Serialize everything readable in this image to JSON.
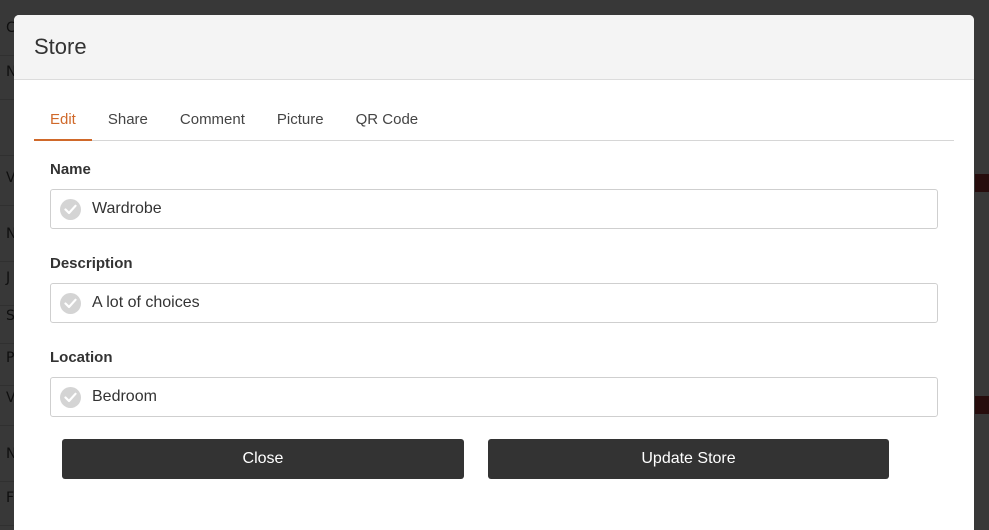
{
  "background": {
    "row_fragments": [
      "C",
      "N",
      "",
      "V",
      "N",
      "J",
      "S",
      "P",
      "V",
      "N",
      "F"
    ]
  },
  "modal": {
    "title": "Store",
    "tabs": [
      {
        "label": "Edit",
        "active": true
      },
      {
        "label": "Share",
        "active": false
      },
      {
        "label": "Comment",
        "active": false
      },
      {
        "label": "Picture",
        "active": false
      },
      {
        "label": "QR Code",
        "active": false
      }
    ],
    "fields": {
      "name": {
        "label": "Name",
        "value": "Wardrobe",
        "icon": "check-circle-icon"
      },
      "description": {
        "label": "Description",
        "value": "A lot of choices",
        "icon": "check-circle-icon"
      },
      "location": {
        "label": "Location",
        "value": "Bedroom",
        "icon": "check-circle-icon"
      }
    },
    "buttons": {
      "close": "Close",
      "update": "Update Store"
    }
  },
  "colors": {
    "accent": "#d0692a",
    "button_bg": "#333333",
    "header_bg": "#f4f4f4"
  }
}
